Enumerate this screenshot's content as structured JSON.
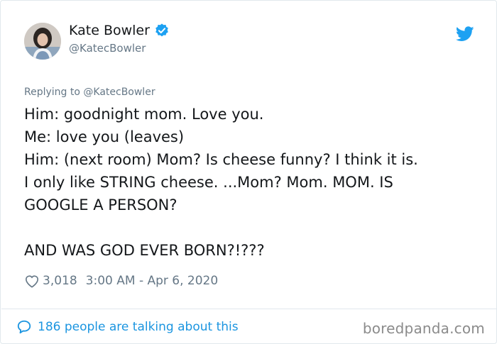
{
  "author": {
    "display_name": "Kate Bowler",
    "handle": "@KatecBowler",
    "verified": true
  },
  "tweet": {
    "replying_to": "Replying to @KatecBowler",
    "text": "Him: goodnight mom. Love you.\nMe: love you (leaves)\nHim: (next room) Mom? Is cheese funny? I think it is.\nI only like STRING cheese. ...Mom? Mom. MOM. IS\nGOOGLE A PERSON?\n\nAND WAS GOD EVER BORN?!???",
    "likes": "3,018",
    "timestamp": "3:00 AM - Apr 6, 2020"
  },
  "footer": {
    "talking_label": "186 people are talking about this"
  },
  "watermark": "boredpanda.com",
  "colors": {
    "twitter_blue": "#1da1f2",
    "link_blue": "#1b95e0",
    "secondary_text": "#657786",
    "border": "#e1e8ed"
  },
  "icons": {
    "verified": "verified-badge-icon",
    "brand": "twitter-bird-icon",
    "like": "heart-icon",
    "reply": "speech-bubble-icon"
  }
}
